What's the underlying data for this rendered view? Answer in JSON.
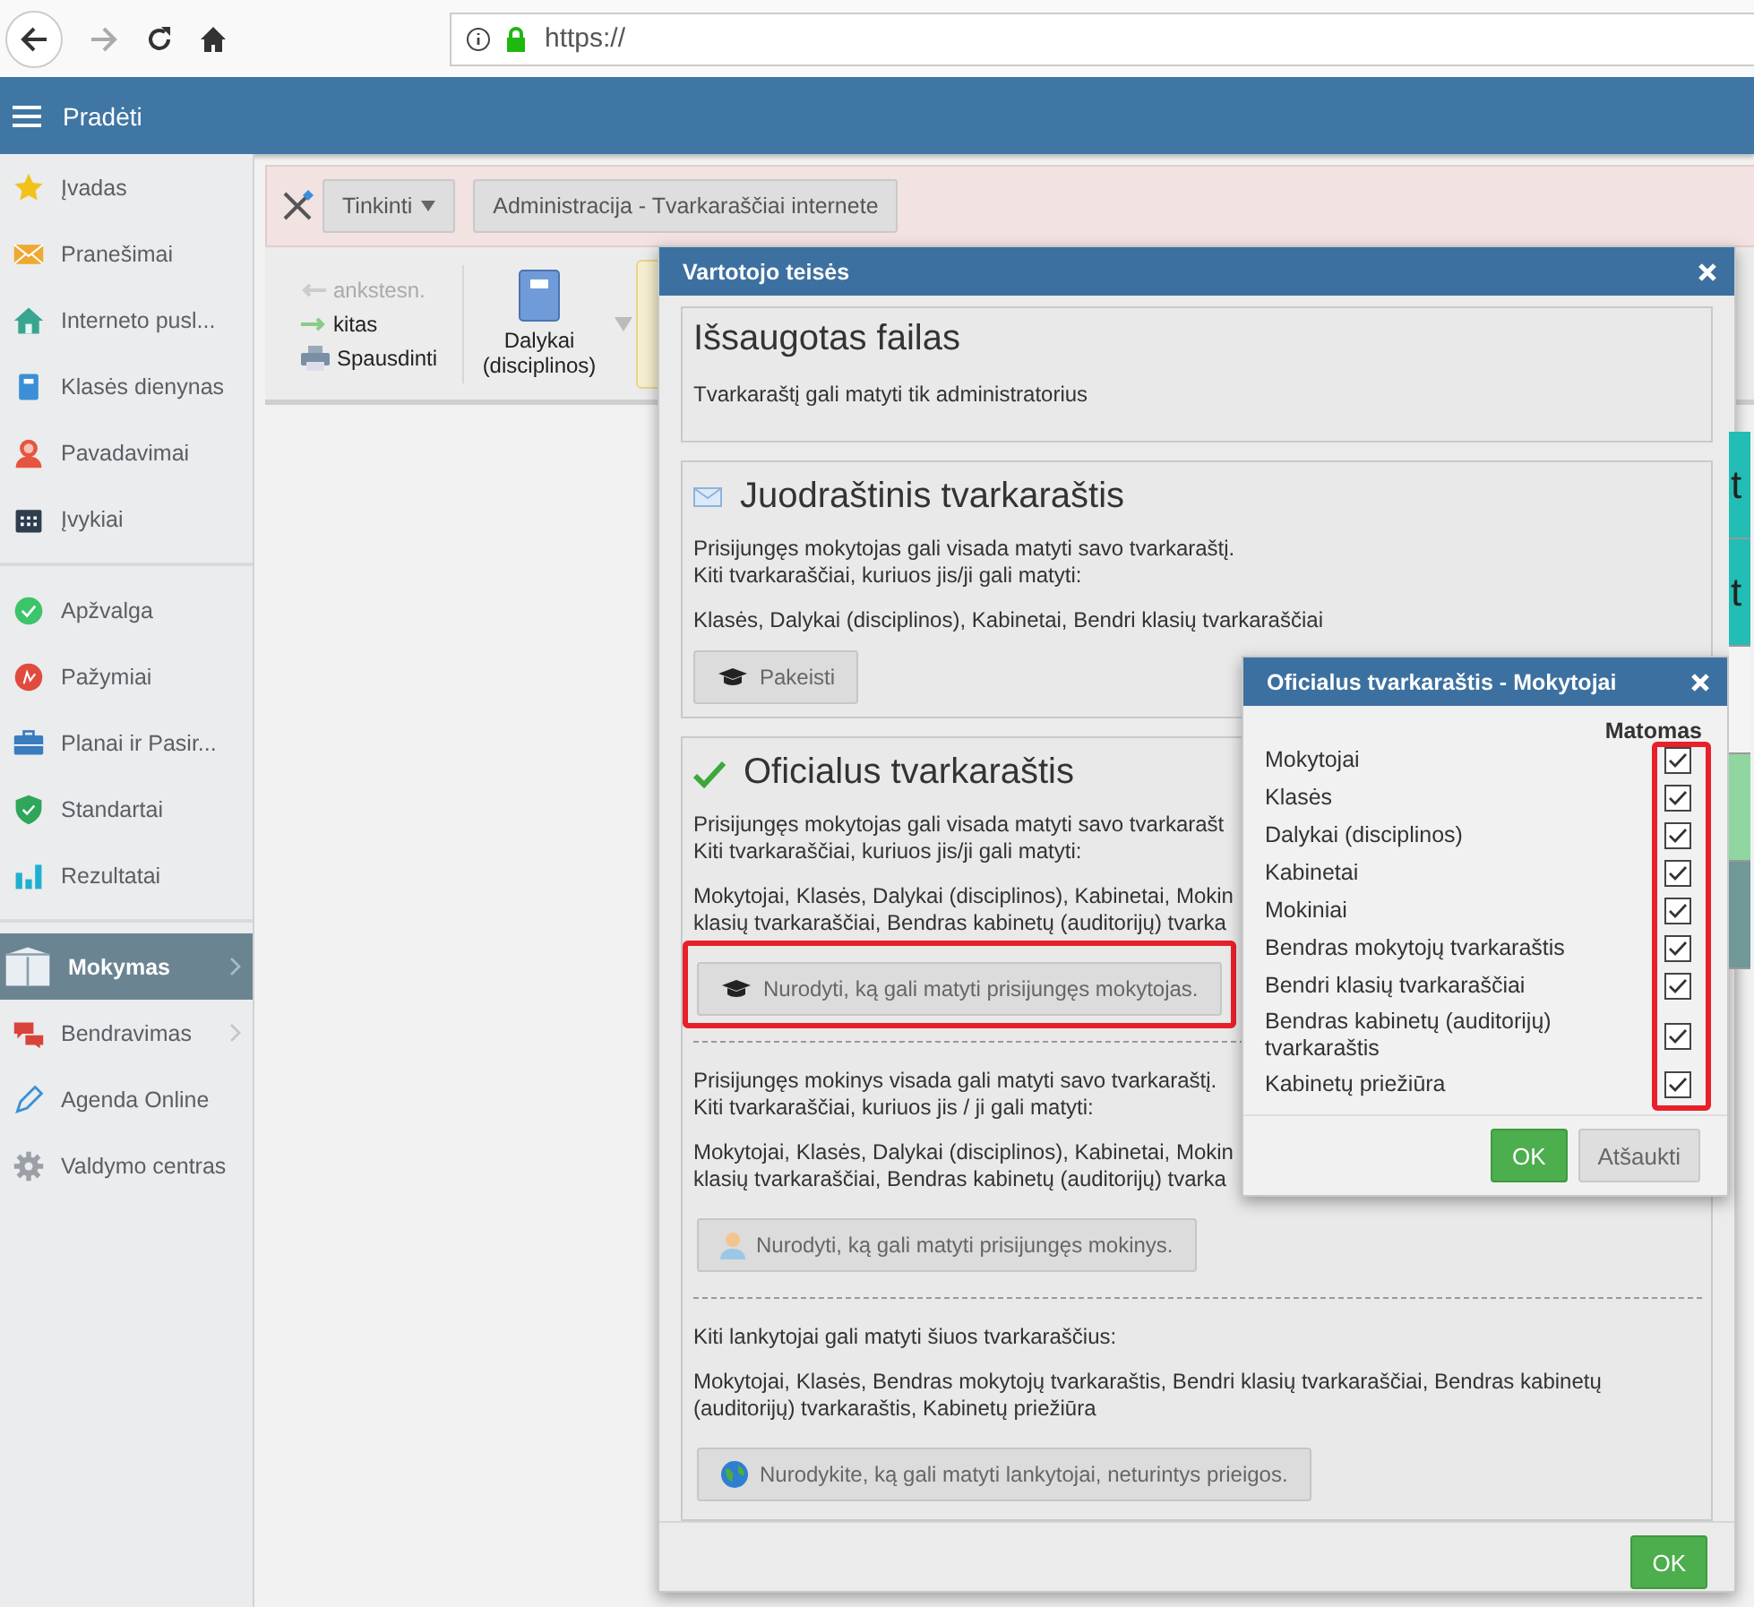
{
  "browser": {
    "url": "https://"
  },
  "header": {
    "menu_label": "Pradėti"
  },
  "sidebar": {
    "groups": [
      {
        "items": [
          {
            "label": "Įvadas",
            "selected": false,
            "submenu": false
          },
          {
            "label": "Pranešimai",
            "selected": false,
            "submenu": false
          },
          {
            "label": "Interneto pusl...",
            "selected": false,
            "submenu": false
          },
          {
            "label": "Klasės dienynas",
            "selected": false,
            "submenu": false
          },
          {
            "label": "Pavadavimai",
            "selected": false,
            "submenu": false
          },
          {
            "label": "Įvykiai",
            "selected": false,
            "submenu": false
          }
        ]
      },
      {
        "items": [
          {
            "label": "Apžvalga",
            "selected": false,
            "submenu": false
          },
          {
            "label": "Pažymiai",
            "selected": false,
            "submenu": false
          },
          {
            "label": "Planai ir Pasir...",
            "selected": false,
            "submenu": false
          },
          {
            "label": "Standartai",
            "selected": false,
            "submenu": false
          },
          {
            "label": "Rezultatai",
            "selected": false,
            "submenu": false
          }
        ]
      },
      {
        "items": [
          {
            "label": "Mokymas",
            "selected": true,
            "submenu": true
          },
          {
            "label": "Bendravimas",
            "selected": false,
            "submenu": true
          },
          {
            "label": "Agenda Online",
            "selected": false,
            "submenu": false
          },
          {
            "label": "Valdymo centras",
            "selected": false,
            "submenu": false
          }
        ]
      }
    ]
  },
  "toolbar": {
    "customize": "Tinkinti",
    "breadcrumb": "Administracija - Tvarkaraščiai internete"
  },
  "nav": {
    "previous": {
      "label": "ankstesn.",
      "disabled": true
    },
    "next": {
      "label": "kitas",
      "disabled": false
    },
    "print": "Spausdinti",
    "view": "Dalykai (disciplinos)"
  },
  "timetable_fragment": [
    {
      "text": "t",
      "color": "#22bdb4"
    },
    {
      "text": "t",
      "color": "#22bdb4"
    },
    {
      "color": "#f4f4f4"
    },
    {
      "color": "#8fd6a0"
    },
    {
      "color": "#6f9896"
    }
  ],
  "dialog": {
    "title": "Vartotojo teisės",
    "saved": {
      "title": "Išsaugotas failas",
      "text": "Tvarkaraštį gali matyti tik administratorius"
    },
    "draft": {
      "title": "Juodraštinis tvarkaraštis",
      "lines": [
        "Prisijungęs mokytojas gali visada matyti savo tvarkaraštį.",
        "Kiti tvarkaraščiai, kuriuos jis/ji gali matyti:"
      ],
      "list": [
        "Klasės, Dalykai (disciplinos), Kabinetai, Bendri klasių tvarkaraščiai"
      ],
      "button": "Pakeisti"
    },
    "official": {
      "title": "Oficialus tvarkaraštis",
      "parts": [
        {
          "kind": "teacher",
          "lines": [
            "Prisijungęs mokytojas gali visada matyti savo tvarkarašt",
            "Kiti tvarkaraščiai, kuriuos jis/ji gali matyti:"
          ],
          "list": [
            "Mokytojai, Klasės, Dalykai (disciplinos), Kabinetai, Mokin",
            "klasių tvarkaraščiai, Bendras kabinetų (auditorijų) tvarka"
          ],
          "button": "Nurodyti, ką gali matyti prisijungęs mokytojas.",
          "highlighted": true
        },
        {
          "kind": "student",
          "lines": [
            "Prisijungęs mokinys visada gali matyti savo tvarkaraštį.",
            "Kiti tvarkaraščiai, kuriuos jis / ji gali matyti:"
          ],
          "list": [
            "Mokytojai, Klasės, Dalykai (disciplinos), Kabinetai, Mokin",
            "klasių tvarkaraščiai, Bendras kabinetų (auditorijų) tvarka"
          ],
          "button": "Nurodyti, ką gali matyti prisijungęs mokinys.",
          "highlighted": false
        },
        {
          "kind": "visitor",
          "lines": [
            "Kiti lankytojai gali matyti šiuos tvarkaraščius:"
          ],
          "list": [
            "Mokytojai, Klasės, Bendras mokytojų tvarkaraštis, Bendri klasių tvarkaraščiai, Bendras kabinetų (auditorijų) tvarkaraštis, Kabinetų priežiūra"
          ],
          "button": "Nurodykite, ką gali matyti lankytojai, neturintys prieigos.",
          "highlighted": false
        }
      ]
    },
    "ok": "OK"
  },
  "subdialog": {
    "title": "Oficialus tvarkaraštis - Mokytojai",
    "column": "Matomas",
    "highlighted": true,
    "rows": [
      {
        "label": "Mokytojai",
        "checked": true
      },
      {
        "label": "Klasės",
        "checked": true
      },
      {
        "label": "Dalykai (disciplinos)",
        "checked": true
      },
      {
        "label": "Kabinetai",
        "checked": true
      },
      {
        "label": "Mokiniai",
        "checked": true
      },
      {
        "label": "Bendras mokytojų tvarkaraštis",
        "checked": true
      },
      {
        "label": "Bendri klasių tvarkaraščiai",
        "checked": true
      },
      {
        "label": "Bendras kabinetų (auditorijų) tvarkaraštis",
        "checked": true
      },
      {
        "label": "Kabinetų priežiūra",
        "checked": true
      }
    ],
    "ok": "OK",
    "cancel": "Atšaukti"
  }
}
